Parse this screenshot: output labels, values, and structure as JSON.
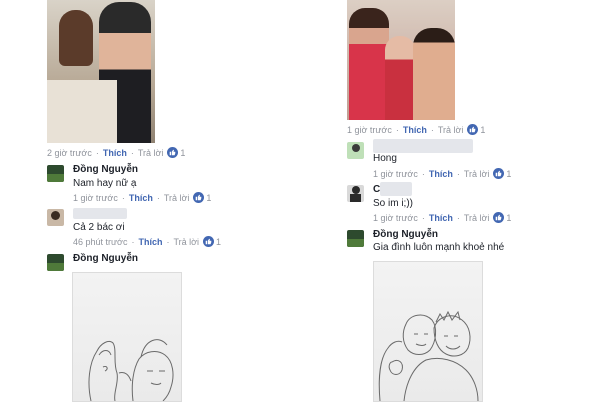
{
  "left": {
    "photo_meta": {
      "time": "2 giờ trước",
      "like": "Thích",
      "reply": "Trả lời",
      "likes": "1"
    },
    "comment1": {
      "author": "Đồng Nguyễn",
      "text": "Nam hay nữ ạ",
      "time": "1 giờ trước",
      "like": "Thích",
      "reply": "Trả lời",
      "likes": "1"
    },
    "comment2": {
      "text": "Cả 2 bác ơi",
      "time": "46 phút trước",
      "like": "Thích",
      "reply": "Trả lời",
      "likes": "1"
    },
    "comment3": {
      "author": "Đồng Nguyễn"
    }
  },
  "right": {
    "photo_meta": {
      "time": "1 giờ trước",
      "like": "Thích",
      "reply": "Trả lời",
      "likes": "1"
    },
    "comment1": {
      "text": "Hong",
      "time": "1 giờ trước",
      "like": "Thích",
      "reply": "Trả lời",
      "likes": "1"
    },
    "comment2": {
      "author_initial": "C",
      "text": "So im i;))",
      "time": "1 giờ trước",
      "like": "Thích",
      "reply": "Trả lời",
      "likes": "1"
    },
    "comment3": {
      "author": "Đồng Nguyễn",
      "text": "Gia đình luôn mạnh khoẻ nhé"
    }
  },
  "icons": {
    "like": "thumbs-up-icon"
  },
  "colors": {
    "link": "#4267b2",
    "meta": "#90949c",
    "text": "#1d2129"
  }
}
